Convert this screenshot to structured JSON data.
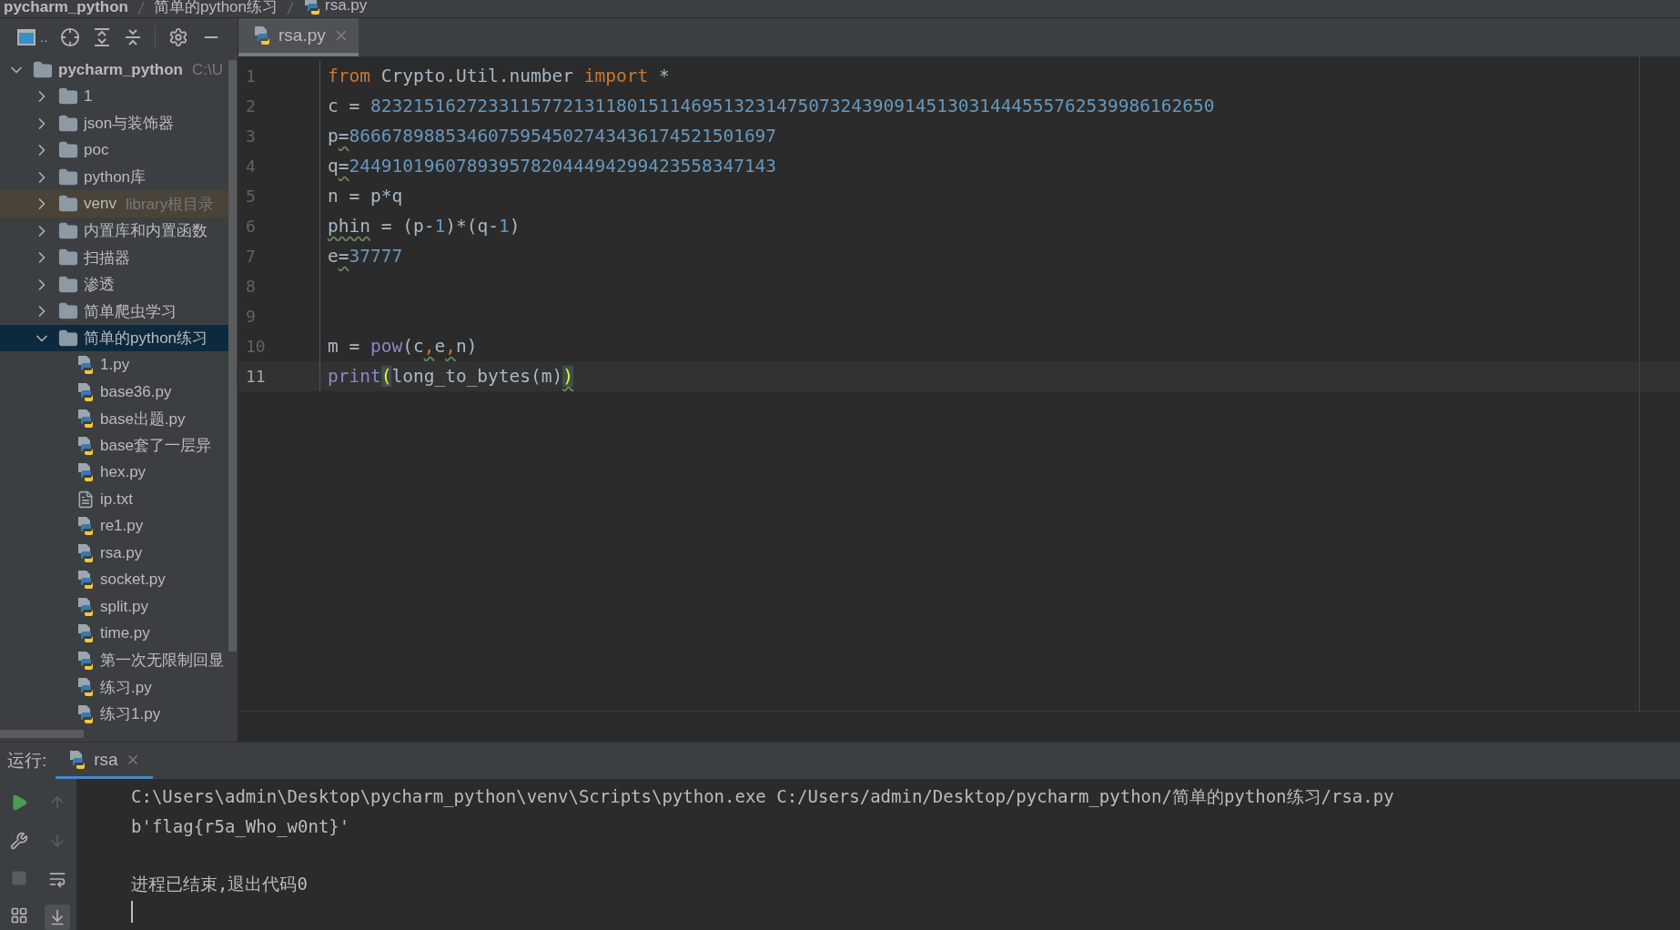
{
  "breadcrumb": [
    "pycharm_python",
    "简单的python练习",
    "rsa.py"
  ],
  "toolbar": {
    "dots": ".."
  },
  "editor_tabs": [
    {
      "label": "rsa.py",
      "selected": true
    }
  ],
  "project_tree": [
    {
      "name": "pycharm_python",
      "hint": "C:\\U",
      "kind": "folder",
      "expanded": true,
      "selected": false,
      "excluded": false,
      "bold": true,
      "children": [
        {
          "name": "1",
          "kind": "folder",
          "expanded": false,
          "selected": false,
          "excluded": false
        },
        {
          "name": "json与装饰器",
          "kind": "folder",
          "expanded": false,
          "selected": false,
          "excluded": false
        },
        {
          "name": "poc",
          "kind": "folder",
          "expanded": false,
          "selected": false,
          "excluded": false
        },
        {
          "name": "python库",
          "kind": "folder",
          "expanded": false,
          "selected": false,
          "excluded": false
        },
        {
          "name": "venv",
          "hint": "library根目录",
          "kind": "folder",
          "expanded": false,
          "selected": false,
          "excluded": true
        },
        {
          "name": "内置库和内置函数",
          "kind": "folder",
          "expanded": false,
          "selected": false,
          "excluded": false
        },
        {
          "name": "扫描器",
          "kind": "folder",
          "expanded": false,
          "selected": false,
          "excluded": false
        },
        {
          "name": "渗透",
          "kind": "folder",
          "expanded": false,
          "selected": false,
          "excluded": false
        },
        {
          "name": "简单爬虫学习",
          "kind": "folder",
          "expanded": false,
          "selected": false,
          "excluded": false
        },
        {
          "name": "简单的python练习",
          "kind": "folder",
          "expanded": true,
          "selected": true,
          "excluded": false,
          "children": [
            {
              "name": "1.py",
              "kind": "py",
              "selected": false
            },
            {
              "name": "base36.py",
              "kind": "py",
              "selected": false
            },
            {
              "name": "base出题.py",
              "kind": "py",
              "selected": false
            },
            {
              "name": "base套了一层异",
              "kind": "py",
              "selected": false
            },
            {
              "name": "hex.py",
              "kind": "py",
              "selected": false
            },
            {
              "name": "ip.txt",
              "kind": "txt",
              "selected": false
            },
            {
              "name": "re1.py",
              "kind": "py",
              "selected": false
            },
            {
              "name": "rsa.py",
              "kind": "py",
              "selected": false
            },
            {
              "name": "socket.py",
              "kind": "py",
              "selected": false
            },
            {
              "name": "split.py",
              "kind": "py",
              "selected": false
            },
            {
              "name": "time.py",
              "kind": "py",
              "selected": false
            },
            {
              "name": "第一次无限制回显",
              "kind": "py",
              "selected": false
            },
            {
              "name": "练习.py",
              "kind": "py",
              "selected": false
            },
            {
              "name": "练习1.py",
              "kind": "py",
              "selected": false
            }
          ]
        }
      ]
    }
  ],
  "code_lines": [
    {
      "number": "1",
      "current": false,
      "tokens": [
        {
          "text": "from",
          "kind": "keyword",
          "warn": false
        },
        {
          "text": " Crypto.Util.number ",
          "kind": "plain",
          "warn": false
        },
        {
          "text": "import",
          "kind": "keyword",
          "warn": false
        },
        {
          "text": " *",
          "kind": "plain",
          "warn": false
        }
      ]
    },
    {
      "number": "2",
      "current": false,
      "tokens": [
        {
          "text": "c = ",
          "kind": "plain",
          "warn": false
        },
        {
          "text": "8232151627233115772131180151146951323147507324390914513031444555762539986162650",
          "kind": "number",
          "warn": false
        }
      ]
    },
    {
      "number": "3",
      "current": false,
      "tokens": [
        {
          "text": "p",
          "kind": "plain",
          "warn": false
        },
        {
          "text": "=",
          "kind": "plain",
          "warn": true
        },
        {
          "text": "8666789885346075954502743436174521501697",
          "kind": "number",
          "warn": false
        }
      ]
    },
    {
      "number": "4",
      "current": false,
      "tokens": [
        {
          "text": "q",
          "kind": "plain",
          "warn": false
        },
        {
          "text": "=",
          "kind": "plain",
          "warn": true
        },
        {
          "text": "2449101960789395782044494299423558347143",
          "kind": "number",
          "warn": false
        }
      ]
    },
    {
      "number": "5",
      "current": false,
      "tokens": [
        {
          "text": "n = p*q",
          "kind": "plain",
          "warn": false
        }
      ]
    },
    {
      "number": "6",
      "current": false,
      "tokens": [
        {
          "text": "phin",
          "kind": "plain",
          "warn": true
        },
        {
          "text": " = (p-",
          "kind": "plain",
          "warn": false
        },
        {
          "text": "1",
          "kind": "number",
          "warn": false
        },
        {
          "text": ")*(q-",
          "kind": "plain",
          "warn": false
        },
        {
          "text": "1",
          "kind": "number",
          "warn": false
        },
        {
          "text": ")",
          "kind": "plain",
          "warn": false
        }
      ]
    },
    {
      "number": "7",
      "current": false,
      "tokens": [
        {
          "text": "e",
          "kind": "plain",
          "warn": false
        },
        {
          "text": "=",
          "kind": "plain",
          "warn": true
        },
        {
          "text": "37777",
          "kind": "number",
          "warn": false
        }
      ]
    },
    {
      "number": "8",
      "current": false
    },
    {
      "number": "9",
      "current": false
    },
    {
      "number": "10",
      "current": false,
      "tokens": [
        {
          "text": "m = ",
          "kind": "plain",
          "warn": false
        },
        {
          "text": "pow",
          "kind": "builtin",
          "warn": false
        },
        {
          "text": "(c",
          "kind": "plain",
          "warn": false
        },
        {
          "text": ",",
          "kind": "comma",
          "warn": true
        },
        {
          "text": "e",
          "kind": "plain",
          "warn": false
        },
        {
          "text": ",",
          "kind": "comma",
          "warn": true
        },
        {
          "text": "n)",
          "kind": "plain",
          "warn": false
        }
      ]
    },
    {
      "number": "11",
      "current": true,
      "tokens": [
        {
          "text": "print",
          "kind": "builtin",
          "warn": false
        },
        {
          "text": "(",
          "kind": "bracket",
          "warn": false
        },
        {
          "text": "long_to_bytes(m)",
          "kind": "plain",
          "warn": false
        },
        {
          "text": ")",
          "kind": "bracket",
          "warn": true
        }
      ]
    }
  ],
  "run_panel": {
    "label": "运行:",
    "tabs": [
      {
        "label": "rsa",
        "selected": true
      }
    ],
    "console_blocks": [
      {
        "lines": [
          "C:\\Users\\admin\\Desktop\\pycharm_python\\venv\\Scripts\\python.exe C:/Users/admin/Desktop/pycharm_python/简单的python练习/rsa.py",
          "b'flag{r5a_Who_w0nt}'"
        ]
      },
      {
        "lines": [
          "进程已结束,退出代码0"
        ]
      }
    ]
  }
}
